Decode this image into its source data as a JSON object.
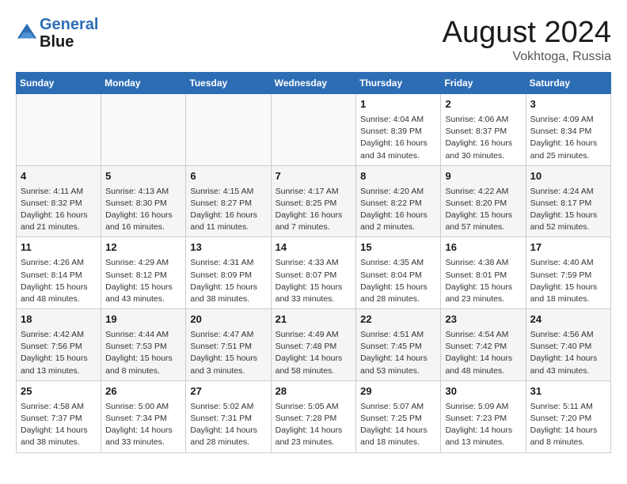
{
  "logo": {
    "line1": "General",
    "line2": "Blue"
  },
  "title": "August 2024",
  "location": "Vokhtoga, Russia",
  "weekdays": [
    "Sunday",
    "Monday",
    "Tuesday",
    "Wednesday",
    "Thursday",
    "Friday",
    "Saturday"
  ],
  "weeks": [
    [
      {
        "day": "",
        "info": ""
      },
      {
        "day": "",
        "info": ""
      },
      {
        "day": "",
        "info": ""
      },
      {
        "day": "",
        "info": ""
      },
      {
        "day": "1",
        "info": "Sunrise: 4:04 AM\nSunset: 8:39 PM\nDaylight: 16 hours\nand 34 minutes."
      },
      {
        "day": "2",
        "info": "Sunrise: 4:06 AM\nSunset: 8:37 PM\nDaylight: 16 hours\nand 30 minutes."
      },
      {
        "day": "3",
        "info": "Sunrise: 4:09 AM\nSunset: 8:34 PM\nDaylight: 16 hours\nand 25 minutes."
      }
    ],
    [
      {
        "day": "4",
        "info": "Sunrise: 4:11 AM\nSunset: 8:32 PM\nDaylight: 16 hours\nand 21 minutes."
      },
      {
        "day": "5",
        "info": "Sunrise: 4:13 AM\nSunset: 8:30 PM\nDaylight: 16 hours\nand 16 minutes."
      },
      {
        "day": "6",
        "info": "Sunrise: 4:15 AM\nSunset: 8:27 PM\nDaylight: 16 hours\nand 11 minutes."
      },
      {
        "day": "7",
        "info": "Sunrise: 4:17 AM\nSunset: 8:25 PM\nDaylight: 16 hours\nand 7 minutes."
      },
      {
        "day": "8",
        "info": "Sunrise: 4:20 AM\nSunset: 8:22 PM\nDaylight: 16 hours\nand 2 minutes."
      },
      {
        "day": "9",
        "info": "Sunrise: 4:22 AM\nSunset: 8:20 PM\nDaylight: 15 hours\nand 57 minutes."
      },
      {
        "day": "10",
        "info": "Sunrise: 4:24 AM\nSunset: 8:17 PM\nDaylight: 15 hours\nand 52 minutes."
      }
    ],
    [
      {
        "day": "11",
        "info": "Sunrise: 4:26 AM\nSunset: 8:14 PM\nDaylight: 15 hours\nand 48 minutes."
      },
      {
        "day": "12",
        "info": "Sunrise: 4:29 AM\nSunset: 8:12 PM\nDaylight: 15 hours\nand 43 minutes."
      },
      {
        "day": "13",
        "info": "Sunrise: 4:31 AM\nSunset: 8:09 PM\nDaylight: 15 hours\nand 38 minutes."
      },
      {
        "day": "14",
        "info": "Sunrise: 4:33 AM\nSunset: 8:07 PM\nDaylight: 15 hours\nand 33 minutes."
      },
      {
        "day": "15",
        "info": "Sunrise: 4:35 AM\nSunset: 8:04 PM\nDaylight: 15 hours\nand 28 minutes."
      },
      {
        "day": "16",
        "info": "Sunrise: 4:38 AM\nSunset: 8:01 PM\nDaylight: 15 hours\nand 23 minutes."
      },
      {
        "day": "17",
        "info": "Sunrise: 4:40 AM\nSunset: 7:59 PM\nDaylight: 15 hours\nand 18 minutes."
      }
    ],
    [
      {
        "day": "18",
        "info": "Sunrise: 4:42 AM\nSunset: 7:56 PM\nDaylight: 15 hours\nand 13 minutes."
      },
      {
        "day": "19",
        "info": "Sunrise: 4:44 AM\nSunset: 7:53 PM\nDaylight: 15 hours\nand 8 minutes."
      },
      {
        "day": "20",
        "info": "Sunrise: 4:47 AM\nSunset: 7:51 PM\nDaylight: 15 hours\nand 3 minutes."
      },
      {
        "day": "21",
        "info": "Sunrise: 4:49 AM\nSunset: 7:48 PM\nDaylight: 14 hours\nand 58 minutes."
      },
      {
        "day": "22",
        "info": "Sunrise: 4:51 AM\nSunset: 7:45 PM\nDaylight: 14 hours\nand 53 minutes."
      },
      {
        "day": "23",
        "info": "Sunrise: 4:54 AM\nSunset: 7:42 PM\nDaylight: 14 hours\nand 48 minutes."
      },
      {
        "day": "24",
        "info": "Sunrise: 4:56 AM\nSunset: 7:40 PM\nDaylight: 14 hours\nand 43 minutes."
      }
    ],
    [
      {
        "day": "25",
        "info": "Sunrise: 4:58 AM\nSunset: 7:37 PM\nDaylight: 14 hours\nand 38 minutes."
      },
      {
        "day": "26",
        "info": "Sunrise: 5:00 AM\nSunset: 7:34 PM\nDaylight: 14 hours\nand 33 minutes."
      },
      {
        "day": "27",
        "info": "Sunrise: 5:02 AM\nSunset: 7:31 PM\nDaylight: 14 hours\nand 28 minutes."
      },
      {
        "day": "28",
        "info": "Sunrise: 5:05 AM\nSunset: 7:28 PM\nDaylight: 14 hours\nand 23 minutes."
      },
      {
        "day": "29",
        "info": "Sunrise: 5:07 AM\nSunset: 7:25 PM\nDaylight: 14 hours\nand 18 minutes."
      },
      {
        "day": "30",
        "info": "Sunrise: 5:09 AM\nSunset: 7:23 PM\nDaylight: 14 hours\nand 13 minutes."
      },
      {
        "day": "31",
        "info": "Sunrise: 5:11 AM\nSunset: 7:20 PM\nDaylight: 14 hours\nand 8 minutes."
      }
    ]
  ]
}
